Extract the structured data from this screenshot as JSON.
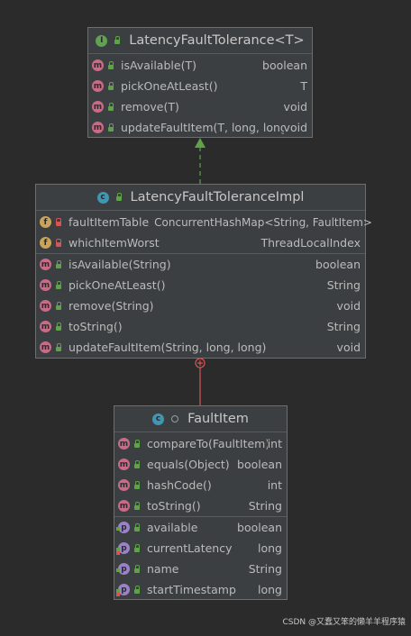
{
  "interface_box": {
    "icon": "interface-icon",
    "title": "LatencyFaultTolerance<T>",
    "methods": [
      {
        "name": "isAvailable(T)",
        "type": "boolean"
      },
      {
        "name": "pickOneAtLeast()",
        "type": "T"
      },
      {
        "name": "remove(T)",
        "type": "void"
      },
      {
        "name": "updateFaultItem(T, long, long)",
        "type": "void"
      }
    ]
  },
  "impl_box": {
    "icon": "class-icon",
    "title": "LatencyFaultToleranceImpl",
    "fields": [
      {
        "name": "faultItemTable",
        "type": "ConcurrentHashMap<String, FaultItem>"
      },
      {
        "name": "whichItemWorst",
        "type": "ThreadLocalIndex"
      }
    ],
    "methods": [
      {
        "name": "isAvailable(String)",
        "type": "boolean"
      },
      {
        "name": "pickOneAtLeast()",
        "type": "String"
      },
      {
        "name": "remove(String)",
        "type": "void"
      },
      {
        "name": "toString()",
        "type": "String"
      },
      {
        "name": "updateFaultItem(String, long, long)",
        "type": "void"
      }
    ]
  },
  "fault_box": {
    "icon": "class-icon",
    "title": "FaultItem",
    "methods": [
      {
        "name": "compareTo(FaultItem)",
        "type": "int"
      },
      {
        "name": "equals(Object)",
        "type": "boolean"
      },
      {
        "name": "hashCode()",
        "type": "int"
      },
      {
        "name": "toString()",
        "type": "String"
      }
    ],
    "properties": [
      {
        "name": "available",
        "type": "boolean"
      },
      {
        "name": "currentLatency",
        "type": "long"
      },
      {
        "name": "name",
        "type": "String"
      },
      {
        "name": "startTimestamp",
        "type": "long"
      }
    ]
  },
  "watermark": "CSDN @又蠢又笨的懒羊羊程序猿",
  "colors": {
    "background": "#2b2b2b",
    "box": "#3c3f41",
    "implements_arrow": "#5fa24a",
    "inner_class_link": "#d65454"
  }
}
